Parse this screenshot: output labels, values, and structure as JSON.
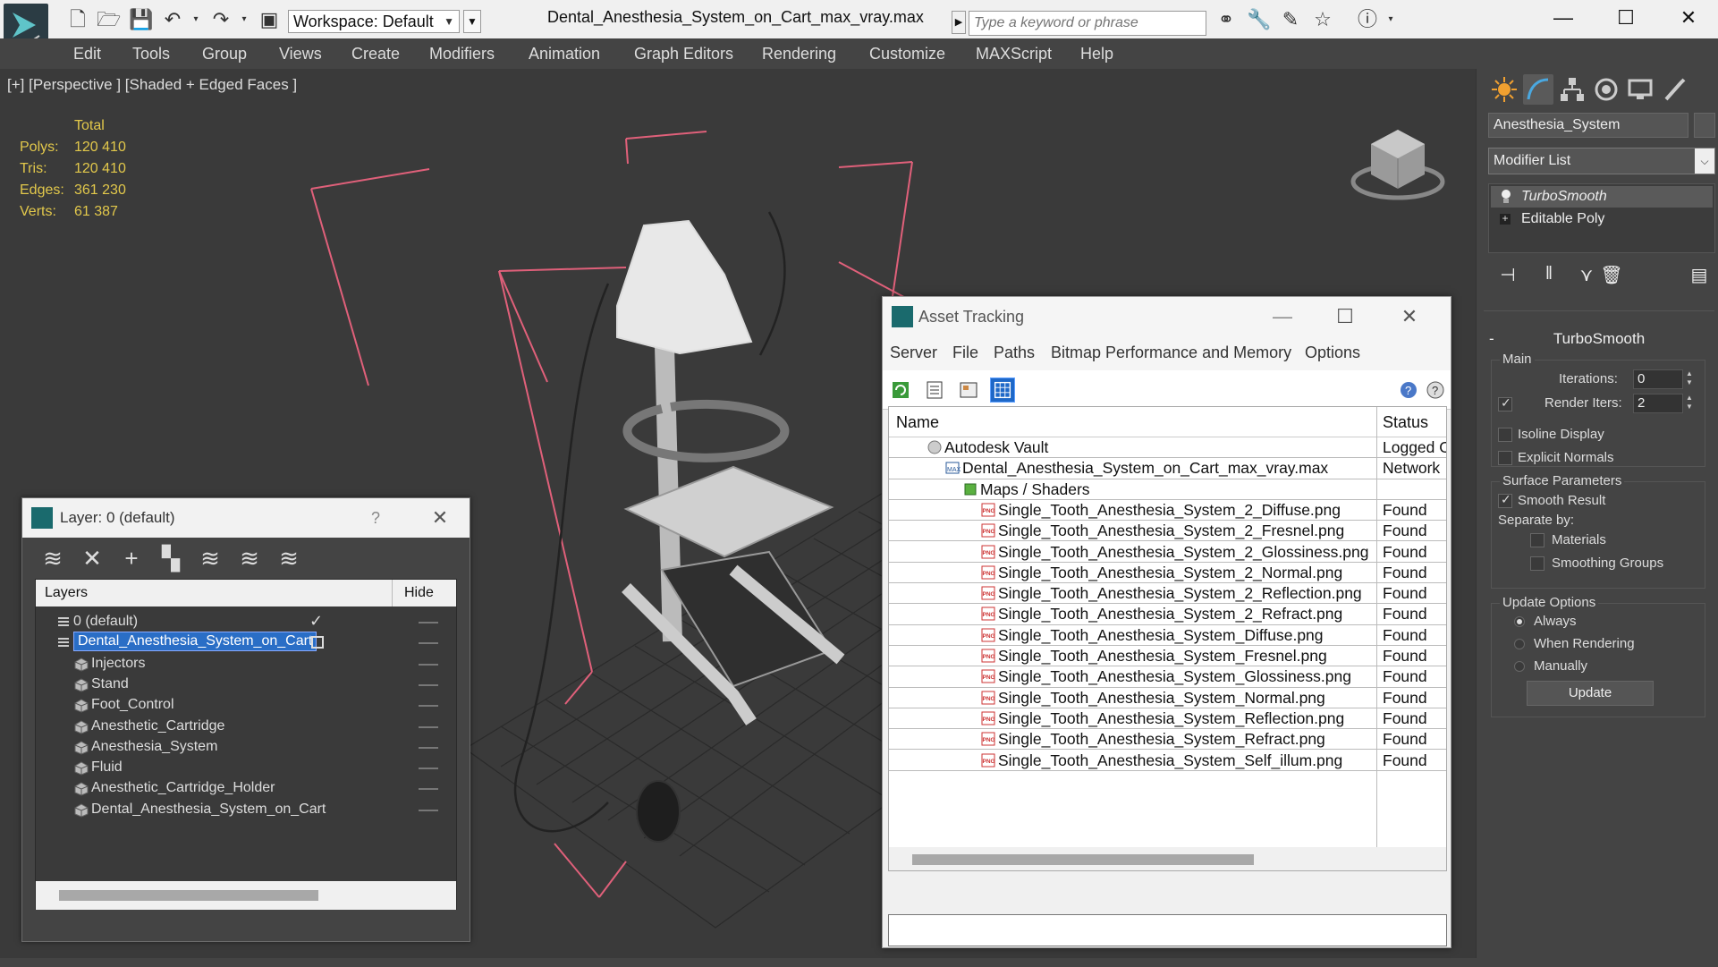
{
  "titlebar": {
    "workspace_label": "Workspace: Default",
    "document_title": "Dental_Anesthesia_System_on_Cart_max_vray.max",
    "search_placeholder": "Type a keyword or phrase",
    "minimize": "—",
    "maximize": "☐",
    "close": "✕"
  },
  "menubar": {
    "items": [
      "Edit",
      "Tools",
      "Group",
      "Views",
      "Create",
      "Modifiers",
      "Animation",
      "Graph Editors",
      "Rendering",
      "Customize",
      "MAXScript",
      "Help"
    ]
  },
  "viewport": {
    "label": "[+] [Perspective ] [Shaded + Edged Faces ]",
    "stats": {
      "header": "Total",
      "rows": [
        {
          "label": "Polys:",
          "value": "120 410"
        },
        {
          "label": "Tris:",
          "value": "120 410"
        },
        {
          "label": "Edges:",
          "value": "361 230"
        },
        {
          "label": "Verts:",
          "value": "61 387"
        }
      ]
    }
  },
  "command_panel": {
    "object_name": "Anesthesia_System",
    "modifier_list": "Modifier List",
    "stack": [
      "TurboSmooth",
      "Editable Poly"
    ],
    "rollout_title": "TurboSmooth",
    "rollout_minus": "-",
    "main_group": "Main",
    "iterations_label": "Iterations:",
    "iterations_value": "0",
    "render_iters_label": "Render Iters:",
    "render_iters_value": "2",
    "isoline_label": "Isoline Display",
    "explicit_normals_label": "Explicit Normals",
    "surface_group": "Surface Parameters",
    "smooth_result_label": "Smooth Result",
    "separate_by_label": "Separate by:",
    "materials_label": "Materials",
    "smoothing_groups_label": "Smoothing Groups",
    "update_group": "Update Options",
    "always_label": "Always",
    "when_rendering_label": "When Rendering",
    "manually_label": "Manually",
    "update_button": "Update"
  },
  "layer_dialog": {
    "title": "Layer: 0 (default)",
    "help": "?",
    "close": "✕",
    "col_layers": "Layers",
    "col_hide": "Hide",
    "rows": [
      {
        "name": "0 (default)",
        "indent": 0
      },
      {
        "name": "Dental_Anesthesia_System_on_Cart",
        "indent": 0
      },
      {
        "name": "Injectors",
        "indent": 1
      },
      {
        "name": "Stand",
        "indent": 1
      },
      {
        "name": "Foot_Control",
        "indent": 1
      },
      {
        "name": "Anesthetic_Cartridge",
        "indent": 1
      },
      {
        "name": "Anesthesia_System",
        "indent": 1
      },
      {
        "name": "Fluid",
        "indent": 1
      },
      {
        "name": "Anesthetic_Cartridge_Holder",
        "indent": 1
      },
      {
        "name": "Dental_Anesthesia_System_on_Cart",
        "indent": 1
      }
    ]
  },
  "asset_dialog": {
    "title": "Asset Tracking",
    "minimize": "—",
    "maximize": "☐",
    "close": "✕",
    "menu": [
      "Server",
      "File",
      "Paths",
      "Bitmap Performance and Memory",
      "Options"
    ],
    "col_name": "Name",
    "col_status": "Status",
    "rows": [
      {
        "name": "Autodesk Vault",
        "status": "Logged O",
        "indent": 1,
        "icon": "vault-icon"
      },
      {
        "name": "Dental_Anesthesia_System_on_Cart_max_vray.max",
        "status": "Network",
        "indent": 2,
        "icon": "max-file-icon"
      },
      {
        "name": "Maps / Shaders",
        "status": "",
        "indent": 3,
        "icon": "maps-icon"
      },
      {
        "name": "Single_Tooth_Anesthesia_System_2_Diffuse.png",
        "status": "Found",
        "indent": 4,
        "icon": "png-icon"
      },
      {
        "name": "Single_Tooth_Anesthesia_System_2_Fresnel.png",
        "status": "Found",
        "indent": 4,
        "icon": "png-icon"
      },
      {
        "name": "Single_Tooth_Anesthesia_System_2_Glossiness.png",
        "status": "Found",
        "indent": 4,
        "icon": "png-icon"
      },
      {
        "name": "Single_Tooth_Anesthesia_System_2_Normal.png",
        "status": "Found",
        "indent": 4,
        "icon": "png-icon"
      },
      {
        "name": "Single_Tooth_Anesthesia_System_2_Reflection.png",
        "status": "Found",
        "indent": 4,
        "icon": "png-icon"
      },
      {
        "name": "Single_Tooth_Anesthesia_System_2_Refract.png",
        "status": "Found",
        "indent": 4,
        "icon": "png-icon"
      },
      {
        "name": "Single_Tooth_Anesthesia_System_Diffuse.png",
        "status": "Found",
        "indent": 4,
        "icon": "png-icon"
      },
      {
        "name": "Single_Tooth_Anesthesia_System_Fresnel.png",
        "status": "Found",
        "indent": 4,
        "icon": "png-icon"
      },
      {
        "name": "Single_Tooth_Anesthesia_System_Glossiness.png",
        "status": "Found",
        "indent": 4,
        "icon": "png-icon"
      },
      {
        "name": "Single_Tooth_Anesthesia_System_Normal.png",
        "status": "Found",
        "indent": 4,
        "icon": "png-icon"
      },
      {
        "name": "Single_Tooth_Anesthesia_System_Reflection.png",
        "status": "Found",
        "indent": 4,
        "icon": "png-icon"
      },
      {
        "name": "Single_Tooth_Anesthesia_System_Refract.png",
        "status": "Found",
        "indent": 4,
        "icon": "png-icon"
      },
      {
        "name": "Single_Tooth_Anesthesia_System_Self_illum.png",
        "status": "Found",
        "indent": 4,
        "icon": "png-icon"
      }
    ]
  },
  "colors": {
    "accent": "#2a6ec6",
    "stats_text": "#e2c84b",
    "bbox_pink": "#e0607a",
    "panel_bg": "#444444"
  }
}
